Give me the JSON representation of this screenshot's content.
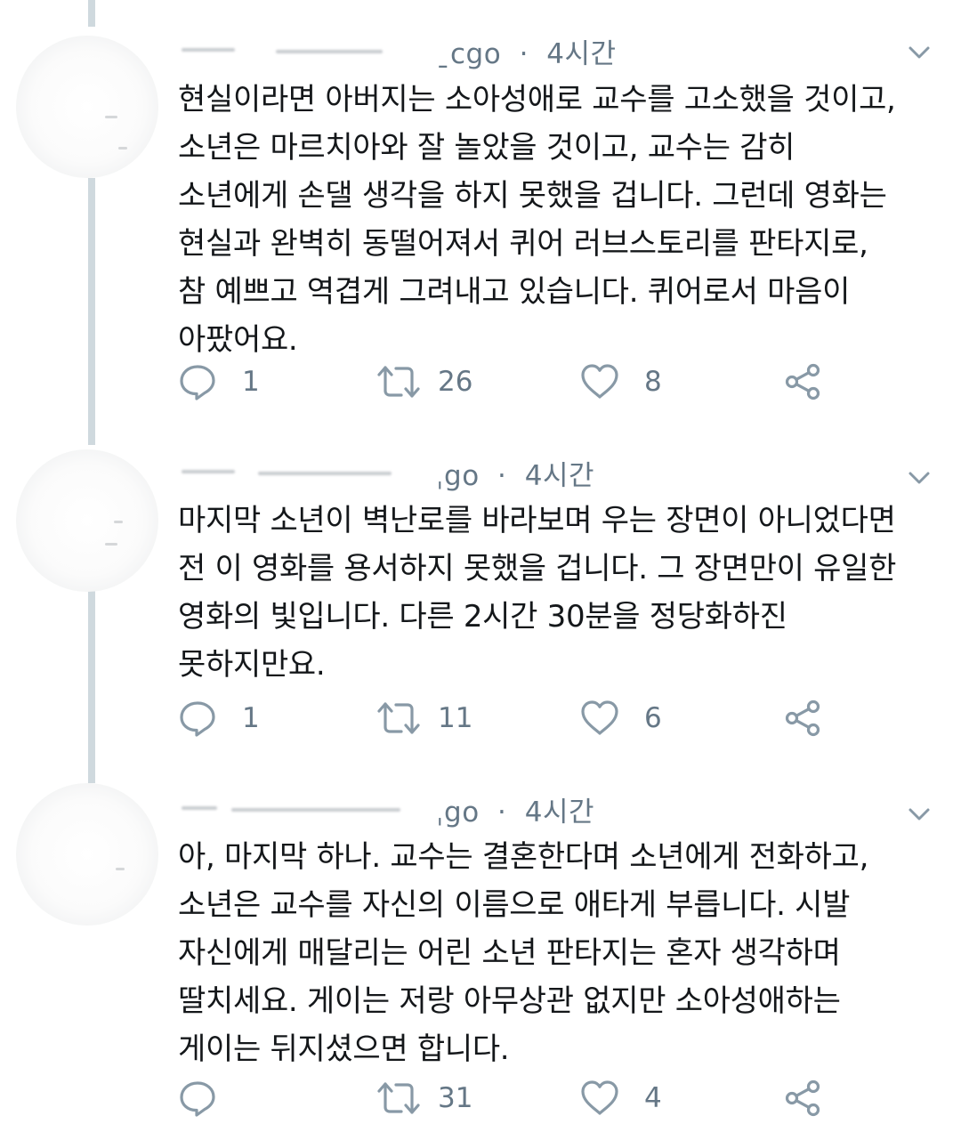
{
  "tweets": [
    {
      "time": "ago · 4시간",
      "tail_prefix": "ˍᴄgo",
      "time_label": "4시간",
      "lines": [
        "현실이라면 아버지는 소아성애로 교수를 고소했을 것이고,",
        "소년은 마르치아와 잘 놀았을 것이고, 교수는 감히",
        "소년에게 손댈 생각을 하지 못했을 겁니다. 그런데 영화는",
        "현실과 완벽히 동떨어져서 퀴어 러브스토리를 판타지로,",
        "참 예쁘고 역겹게 그려내고 있습니다. 퀴어로서 마음이",
        "아팠어요."
      ],
      "reply_count": "1",
      "retweet_count": "26",
      "like_count": "8"
    },
    {
      "tail_prefix": "ˌgo",
      "time_label": "4시간",
      "lines": [
        "마지막 소년이 벽난로를 바라보며 우는 장면이 아니었다면",
        "전 이 영화를 용서하지 못했을 겁니다. 그 장면만이 유일한",
        "영화의 빛입니다. 다른 2시간 30분을 정당화하진",
        "못하지만요."
      ],
      "reply_count": "1",
      "retweet_count": "11",
      "like_count": "6"
    },
    {
      "tail_prefix": "ˌgo",
      "time_label": "4시간",
      "lines": [
        "아, 마지막 하나. 교수는 결혼한다며 소년에게 전화하고,",
        "소년은 교수를 자신의 이름으로 애타게 부릅니다. 시발",
        "자신에게 매달리는 어린 소년 판타지는 혼자 생각하며",
        "딸치세요. 게이는 저랑 아무상관 없지만 소아성애하는",
        "게이는 뒤지셨으면 합니다."
      ],
      "reply_count": "",
      "retweet_count": "31",
      "like_count": "4"
    }
  ],
  "separator": "·",
  "icons": {
    "reply": "reply-icon",
    "retweet": "retweet-icon",
    "like": "heart-icon",
    "share": "share-icon",
    "caret": "chevron-down-icon"
  },
  "colors": {
    "text": "#14171a",
    "secondary": "#657786",
    "thread_line": "#cfd9de"
  }
}
